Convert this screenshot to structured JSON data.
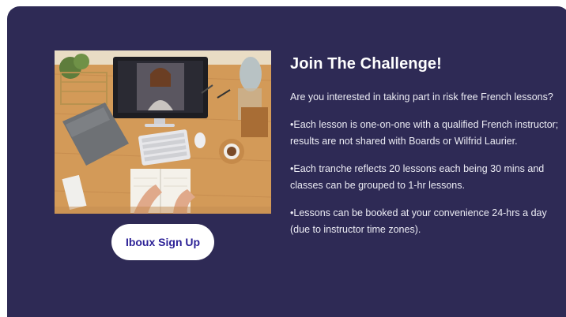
{
  "section": {
    "title": "Join The Challenge!",
    "paragraphs": [
      "Are you interested in taking part in risk free French lessons?",
      "•Each lesson is one-on-one with a qualified French instructor; results are not shared with Boards or Wilfrid Laurier.",
      "•Each tranche reflects 20 lessons each being 30 mins and classes can be grouped to 1-hr lessons.",
      "•Lessons can be booked at your convenience 24-hrs a day (due to instructor time zones)."
    ],
    "signup_label": "Iboux Sign Up"
  },
  "colors": {
    "card_background": "#2e2a55",
    "button_background": "#ffffff",
    "button_text": "#2c2196"
  },
  "image": {
    "icon": "desk-video-call-photo"
  }
}
